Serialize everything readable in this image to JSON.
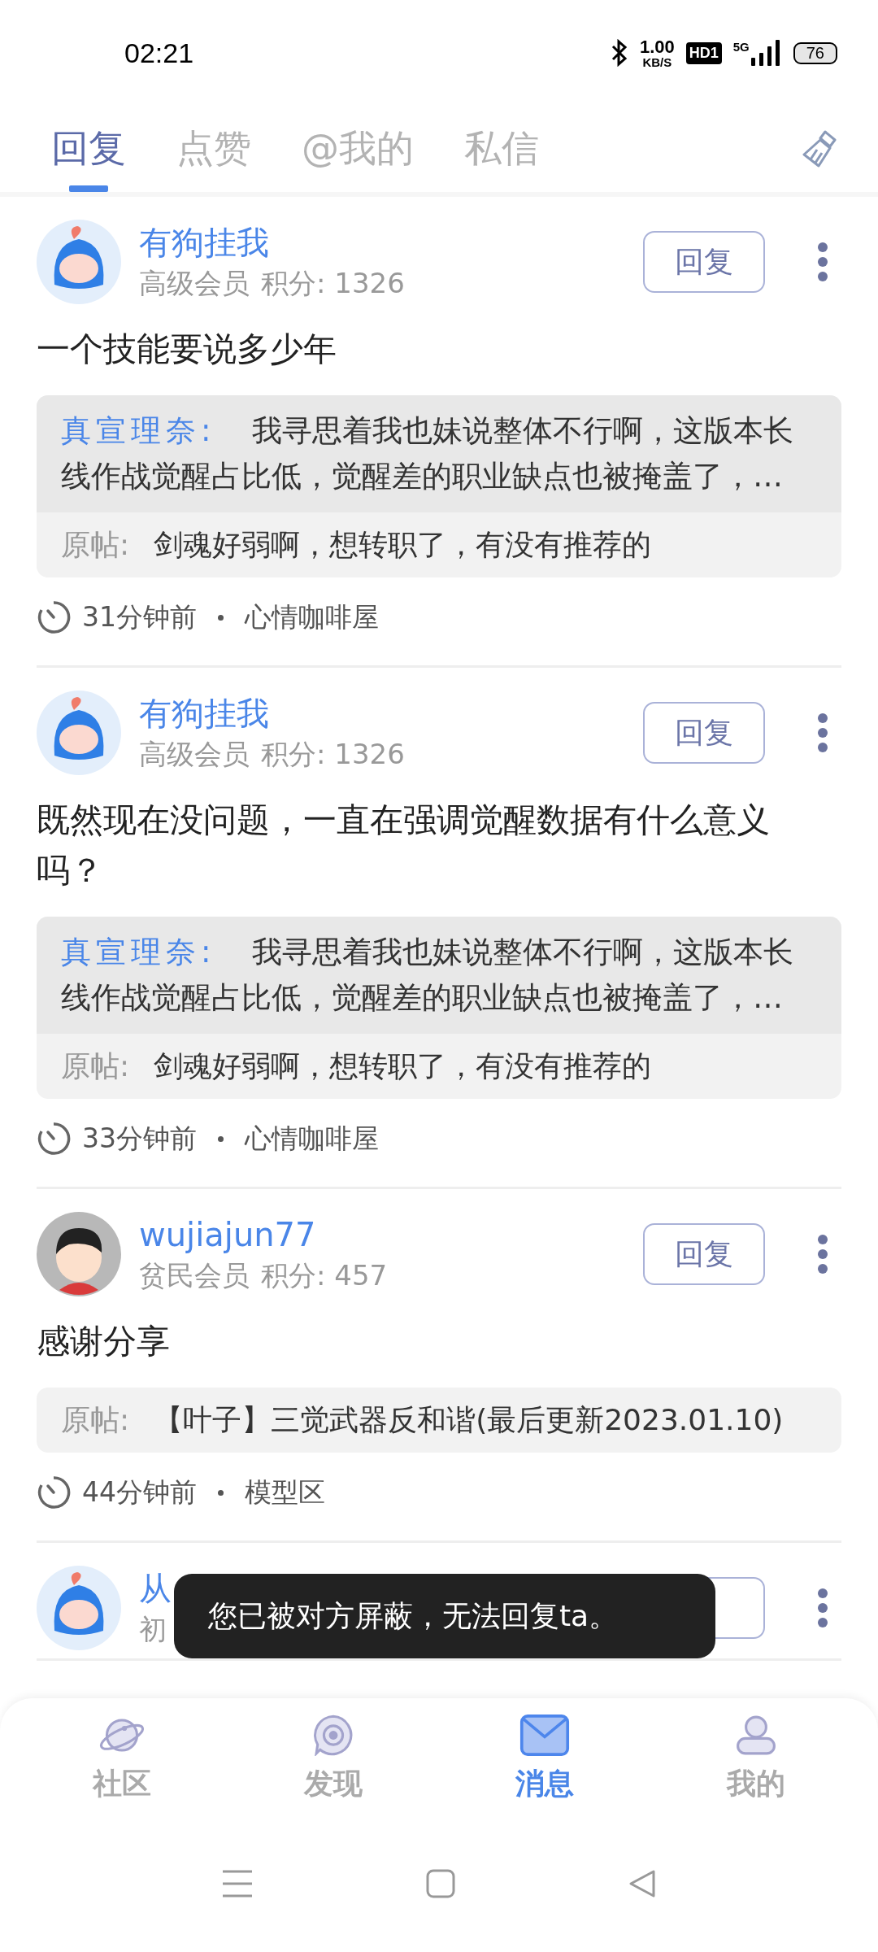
{
  "status_bar": {
    "time": "02:21",
    "speed": "1.00",
    "speed_unit": "KB/S",
    "hd": "HD1",
    "network": "5G",
    "battery": "76"
  },
  "tabs": [
    {
      "label": "回复",
      "selected": true
    },
    {
      "label": "点赞",
      "selected": false
    },
    {
      "label": "@我的",
      "selected": false
    },
    {
      "label": "私信",
      "selected": false
    }
  ],
  "cards": [
    {
      "avatar": {
        "kind": "hood"
      },
      "name": "有狗挂我",
      "level": "高级会员",
      "points": "积分: 1326",
      "reply_label": "回复",
      "content": "一个技能要说多少年",
      "quote": {
        "author": "真宣理奈:",
        "text": "我寻思着我也妹说整体不行啊，这版本长线作战觉醒占比低，觉醒差的职业缺点也被掩盖了，…"
      },
      "original": {
        "label": "原帖:",
        "text": "剑魂好弱啊，想转职了，有没有推荐的"
      },
      "time": "31分钟前",
      "board": "心情咖啡屋"
    },
    {
      "avatar": {
        "kind": "hood"
      },
      "name": "有狗挂我",
      "level": "高级会员",
      "points": "积分: 1326",
      "reply_label": "回复",
      "content": "既然现在没问题，一直在强调觉醒数据有什么意义吗？",
      "quote": {
        "author": "真宣理奈:",
        "text": "我寻思着我也妹说整体不行啊，这版本长线作战觉醒占比低，觉醒差的职业缺点也被掩盖了，…"
      },
      "original": {
        "label": "原帖:",
        "text": "剑魂好弱啊，想转职了，有没有推荐的"
      },
      "time": "33分钟前",
      "board": "心情咖啡屋"
    },
    {
      "avatar": {
        "kind": "boy"
      },
      "name": "wujiajun77",
      "level": "贫民会员",
      "points": "积分: 457",
      "reply_label": "回复",
      "content": "感谢分享",
      "original": {
        "label": "原帖:",
        "text": "【叶子】三觉武器反和谐(最后更新2023.01.10)"
      },
      "time": "44分钟前",
      "board": "模型区"
    },
    {
      "avatar": {
        "kind": "hood"
      },
      "name": "从",
      "level": "初"
    }
  ],
  "toast": "您已被对方屏蔽，无法回复ta。",
  "bottom_nav": [
    {
      "label": "社区",
      "selected": false
    },
    {
      "label": "发现",
      "selected": false
    },
    {
      "label": "消息",
      "selected": true
    },
    {
      "label": "我的",
      "selected": false
    }
  ]
}
